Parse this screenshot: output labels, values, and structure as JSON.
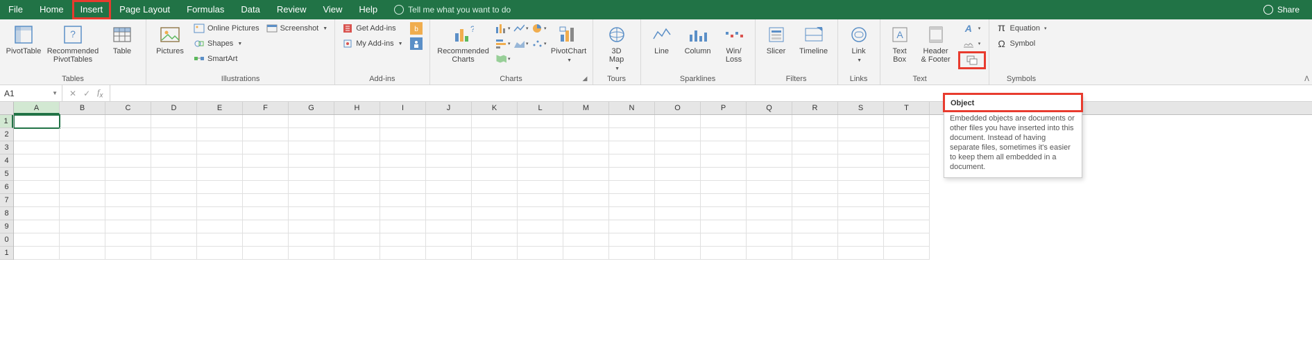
{
  "menubar": {
    "tabs": [
      {
        "label": "File"
      },
      {
        "label": "Home"
      },
      {
        "label": "Insert"
      },
      {
        "label": "Page Layout"
      },
      {
        "label": "Formulas"
      },
      {
        "label": "Data"
      },
      {
        "label": "Review"
      },
      {
        "label": "View"
      },
      {
        "label": "Help"
      }
    ],
    "tellme": "Tell me what you want to do",
    "share": "Share"
  },
  "ribbon": {
    "tables": {
      "pivottable": "PivotTable",
      "recommended": "Recommended\nPivotTables",
      "table": "Table",
      "group": "Tables"
    },
    "illustrations": {
      "pictures": "Pictures",
      "online_pictures": "Online Pictures",
      "shapes": "Shapes",
      "smartart": "SmartArt",
      "screenshot": "Screenshot",
      "group": "Illustrations"
    },
    "addins": {
      "get": "Get Add-ins",
      "my": "My Add-ins",
      "group": "Add-ins"
    },
    "charts": {
      "recommended": "Recommended\nCharts",
      "pivotchart": "PivotChart",
      "group": "Charts"
    },
    "tours": {
      "map": "3D\nMap",
      "group": "Tours"
    },
    "sparklines": {
      "line": "Line",
      "column": "Column",
      "winloss": "Win/\nLoss",
      "group": "Sparklines"
    },
    "filters": {
      "slicer": "Slicer",
      "timeline": "Timeline",
      "group": "Filters"
    },
    "links": {
      "link": "Link",
      "group": "Links"
    },
    "text": {
      "textbox": "Text\nBox",
      "headerfooter": "Header\n& Footer",
      "group": "Text"
    },
    "symbols": {
      "equation": "Equation",
      "symbol": "Symbol",
      "group": "Symbols"
    }
  },
  "formula_bar": {
    "namebox": "A1",
    "formula": ""
  },
  "sheet": {
    "columns": [
      "A",
      "B",
      "C",
      "D",
      "E",
      "F",
      "G",
      "H",
      "I",
      "J",
      "K",
      "L",
      "M",
      "N",
      "O",
      "P",
      "Q",
      "R",
      "S",
      "T"
    ],
    "rows": [
      "1",
      "2",
      "3",
      "4",
      "5",
      "6",
      "7",
      "8",
      "9",
      "0",
      "1"
    ],
    "selected_cell": "A1"
  },
  "tooltip": {
    "title": "Object",
    "body": "Embedded objects are documents or other files you have inserted into this document. Instead of having separate files, sometimes it's easier to keep them all embedded in a document."
  },
  "colors": {
    "brand": "#217346",
    "highlight": "#e83b2e"
  }
}
